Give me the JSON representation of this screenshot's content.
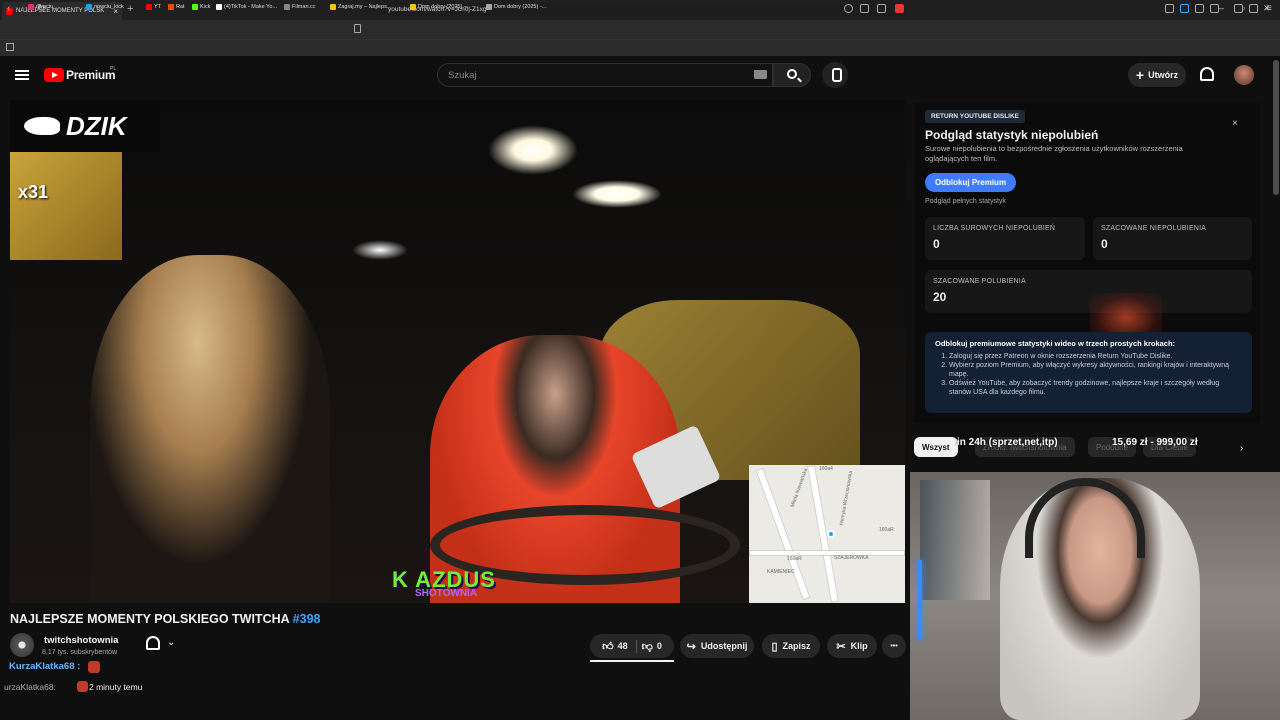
{
  "browser": {
    "tab_title": "NAJLEPSZE MOMENTY POLSK",
    "tab_close": "×",
    "new_tab": "+",
    "url": "youtube.com/watch?v=Jch0j-Z1xg",
    "bookmarks": [
      {
        "label": "nowciu_",
        "color": "#e1306c"
      },
      {
        "label": "nowciu_kick",
        "color": "#1da1f2"
      },
      {
        "label": "YT",
        "color": "#ff0000"
      },
      {
        "label": "Rat",
        "color": "#ff4500"
      },
      {
        "label": "Kick",
        "color": "#53fc18"
      },
      {
        "label": "(4)TikTok - Make Yo...",
        "color": "#ffffff"
      },
      {
        "label": "Filman.cc",
        "color": "#888888"
      },
      {
        "label": "Zagraj.my – Najleps...",
        "color": "#f1c40f"
      },
      {
        "label": "Dom dobry (2025) -...",
        "color": "#f1c40f"
      },
      {
        "label": "Dom dobry (2025) -...",
        "color": "#aaaaaa"
      }
    ]
  },
  "header": {
    "brand": "Premium",
    "brand_region": "PL",
    "search_placeholder": "Szukaj",
    "create_label": "Utwórz",
    "create_icon": "+"
  },
  "video": {
    "overlay_logo": "DZIK",
    "overlay_count": "x31",
    "overlay_text": "K AZDUS",
    "overlay_sub": "SHOTOWNIA",
    "map_labels": [
      "Mitela Narwiańska",
      "Henryka Wrzecionowska",
      "SZAJEROWKA",
      "KAMIENIEC",
      "160a4",
      "160aR",
      "160aR"
    ]
  },
  "meta": {
    "title": "NAJLEPSZE MOMENTY POLSKIEGO TWITCHA",
    "episode": "#398",
    "channel_name": "twitchshotownia",
    "channel_subs": "8,17 tys. subskrybentów",
    "likes": "48",
    "dislikes": "0",
    "share_label": "Udostępnij",
    "save_label": "Zapisz",
    "clip_label": "Klip",
    "more_label": "•••",
    "chevron": "⌄"
  },
  "chat": {
    "user1": "KurzaKlatka68 :",
    "user2": "urzaKlatka68:",
    "time_text": "2 minuty temu"
  },
  "ryd": {
    "badge": "RETURN YOUTUBE DISLIKE",
    "close": "×",
    "title": "Podgląd statystyk niepolubień",
    "description": "Surowe niepolubienia to bezpośrednie zgłoszenia użytkowników rozszerzenia oglądających ten film.",
    "unlock_label": "Odblokuj Premium",
    "full_stats": "Podgląd pełnych statystyk",
    "stats": [
      {
        "label": "LICZBA SUROWYCH NIEPOLUBIEŃ",
        "value": "0"
      },
      {
        "label": "SZACOWANE NIEPOLUBIENIA",
        "value": "0"
      },
      {
        "label": "SZACOWANE POLUBIENIA",
        "value": "20"
      }
    ],
    "premium_heading": "Odblokuj premiumowe statystyki wideo w trzech prostych krokach:",
    "steps": [
      "Zaloguj się przez Patreon w oknie rozszerzenia Return YouTube Dislike.",
      "Wybierz poziom Premium, aby włączyć wykresy aktywności, rankingi krajów i interaktywną mapę.",
      "Odśwież YouTube, aby zobaczyć trendy godzinowe, najlepsze kraje i szczegóły według stanów USA dla każdego filmu."
    ]
  },
  "chips": {
    "all": "Wszyst",
    "donation": "in 24h (sprzet,net,itp)",
    "amount": "15,69 zł - 999,00 zł",
    "dim1": "Źródło: twitchshotownia",
    "dim2": "Podobne",
    "dim3": "Dla Ciebie",
    "next": "›"
  },
  "colors": {
    "accent_blue": "#3ea6ff",
    "yt_red": "#ff0000",
    "unlock_blue": "#3e7bff"
  }
}
